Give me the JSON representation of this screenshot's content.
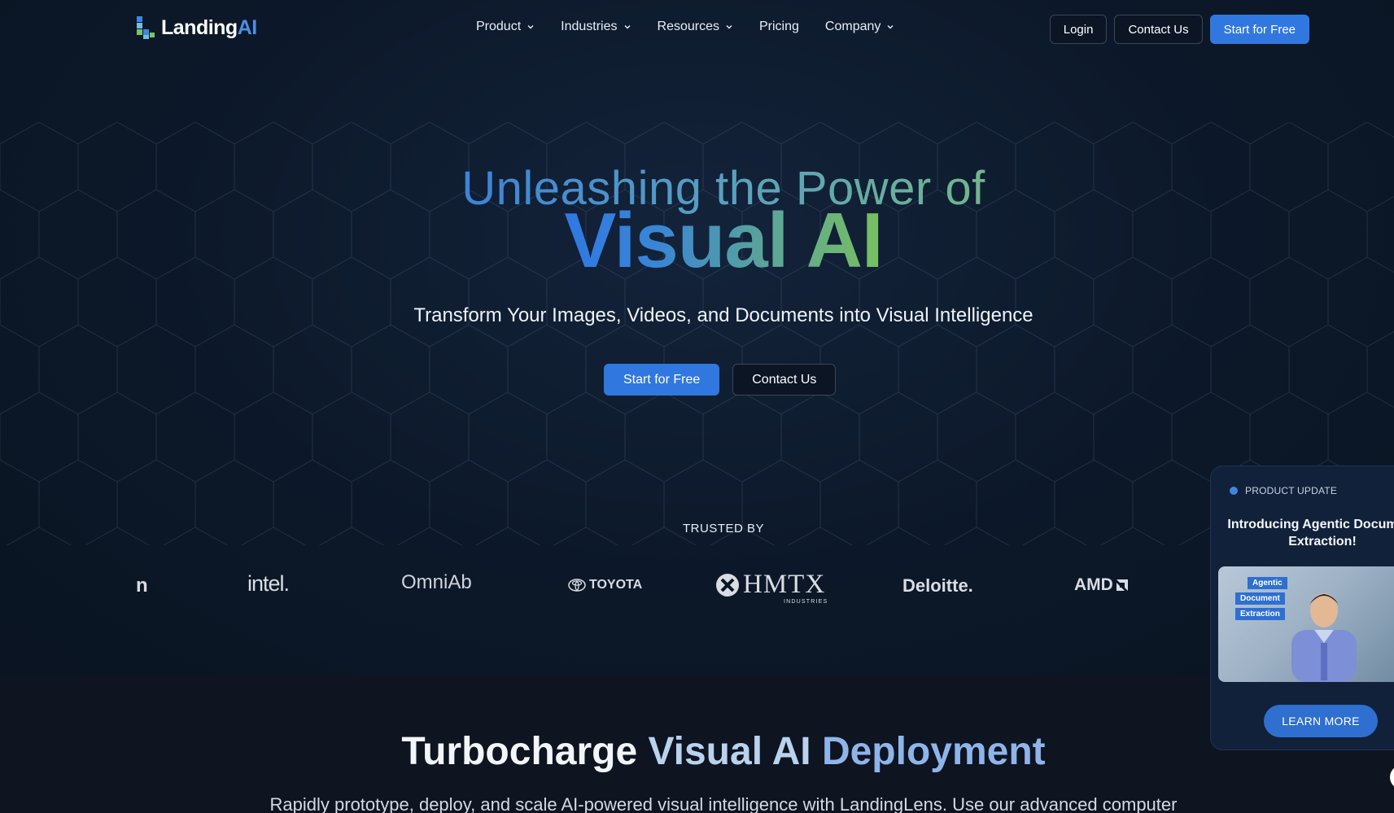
{
  "header": {
    "logo": {
      "part1": "Landing",
      "part2": "AI"
    },
    "nav": [
      {
        "label": "Product",
        "has_dropdown": true
      },
      {
        "label": "Industries",
        "has_dropdown": true
      },
      {
        "label": "Resources",
        "has_dropdown": true
      },
      {
        "label": "Pricing",
        "has_dropdown": false
      },
      {
        "label": "Company",
        "has_dropdown": true
      }
    ],
    "actions": {
      "login": "Login",
      "contact": "Contact Us",
      "start": "Start for Free"
    }
  },
  "hero": {
    "kicker": "Unleashing the Power of",
    "title": "Visual AI",
    "subtitle": "Transform Your Images, Videos, and Documents into Visual Intelligence",
    "cta_primary": "Start for Free",
    "cta_secondary": "Contact Us"
  },
  "trusted": {
    "label": "TRUSTED BY",
    "logos": [
      "n",
      "intel.",
      "OmniAb",
      "TOYOTA",
      "HMTX",
      "INDUSTRIES",
      "Deloitte.",
      "AMD"
    ]
  },
  "section": {
    "title_w": "Turbocharge",
    "title_g1": "Visual AI",
    "title_g2": "Deployment",
    "description": "Rapidly prototype, deploy, and scale AI-powered visual intelligence with LandingLens. Use our advanced computer"
  },
  "update_card": {
    "tag": "PRODUCT UPDATE",
    "title": "Introducing Agentic Document Extraction!",
    "media_badges": [
      "Agentic",
      "Document",
      "Extraction"
    ],
    "cta": "LEARN MORE"
  },
  "colors": {
    "background": "#0b1524",
    "primary": "#3078e0",
    "gradient_blue": "#2f78e3",
    "gradient_green": "#78c060"
  }
}
